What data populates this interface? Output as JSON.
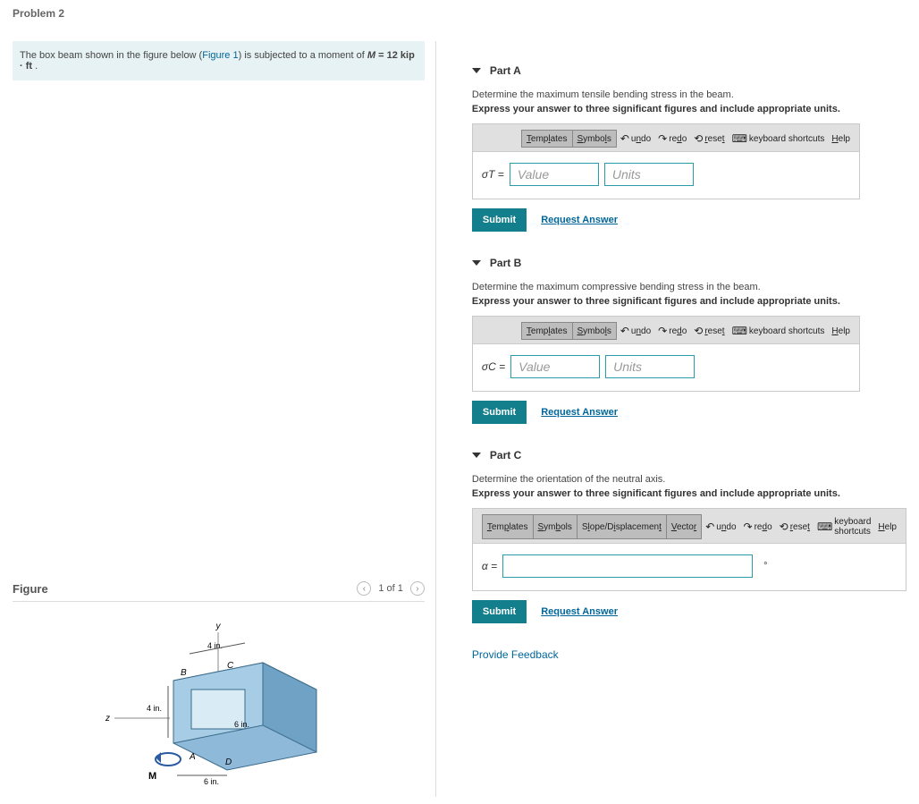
{
  "title": "Problem 2",
  "stem": {
    "pre": "The box beam shown in the figure below (",
    "figref": "Figure 1",
    "mid": ") is subjected to a moment of ",
    "mvar": "M",
    "eq": " = 12 kip · ft",
    "end": " ."
  },
  "figure": {
    "label": "Figure",
    "counter": "1 of 1",
    "dim_top": "4 in.",
    "dim_left": "4 in.",
    "dim_bottom": "6 in.",
    "dim_inner": "6 in.",
    "axes": {
      "y": "y",
      "z": "z"
    },
    "pts": {
      "a": "A",
      "b": "B",
      "c": "C",
      "d": "D"
    },
    "moment": "M"
  },
  "toolbar": {
    "templates": "Templates",
    "symbols": "Symbols",
    "slope": "Slope/Displacement",
    "vector": "Vector",
    "undo": "undo",
    "redo": "redo",
    "reset": "reset",
    "keyboard": "keyboard shortcuts",
    "help": "Help"
  },
  "parts": {
    "a": {
      "title": "Part A",
      "prompt": "Determine the maximum tensile bending stress in the beam.",
      "express": "Express your answer to three significant figures and include appropriate units.",
      "var": "σT =",
      "value_ph": "Value",
      "units_ph": "Units"
    },
    "b": {
      "title": "Part B",
      "prompt": "Determine the maximum compressive bending stress in the beam.",
      "express": "Express your answer to three significant figures and include appropriate units.",
      "var": "σC =",
      "value_ph": "Value",
      "units_ph": "Units"
    },
    "c": {
      "title": "Part C",
      "prompt": "Determine the orientation of the neutral axis.",
      "express": "Express your answer to three significant figures and include appropriate units.",
      "var": "α =",
      "unit_suffix": "°"
    }
  },
  "actions": {
    "submit": "Submit",
    "request": "Request Answer",
    "feedback": "Provide Feedback"
  }
}
